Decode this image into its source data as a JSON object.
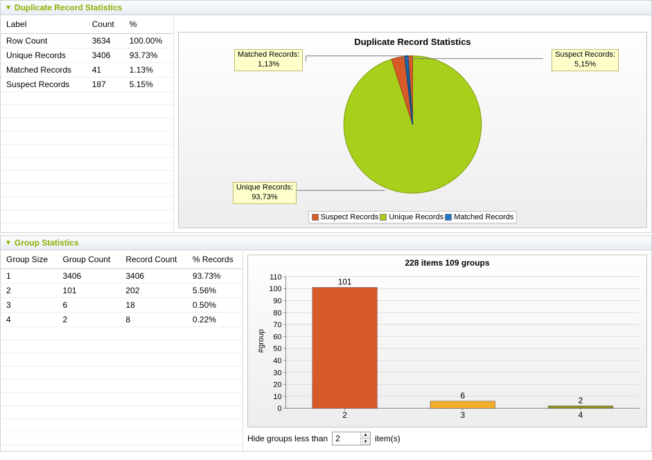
{
  "panel1": {
    "title": "Duplicate Record Statistics",
    "table": {
      "headers": [
        "Label",
        "Count",
        "%"
      ],
      "rows": [
        {
          "label": "Row Count",
          "count": "3634",
          "pct": "100.00%"
        },
        {
          "label": "Unique Records",
          "count": "3406",
          "pct": "93.73%"
        },
        {
          "label": "Matched Records",
          "count": "41",
          "pct": "1.13%"
        },
        {
          "label": "Suspect Records",
          "count": "187",
          "pct": "5.15%"
        }
      ]
    },
    "chart_title": "Duplicate Record Statistics",
    "callouts": {
      "matched": {
        "l1": "Matched Records:",
        "l2": "1,13%"
      },
      "suspect": {
        "l1": "Suspect Records:",
        "l2": "5,15%"
      },
      "unique": {
        "l1": "Unique Records:",
        "l2": "93,73%"
      }
    },
    "legend": [
      "Suspect Records",
      "Unique Records",
      "Matched Records"
    ],
    "legend_colors": [
      "#d85a28",
      "#a8cf1c",
      "#1c77c8"
    ]
  },
  "panel2": {
    "title": "Group Statistics",
    "table": {
      "headers": [
        "Group Size",
        "Group Count",
        "Record Count",
        "% Records"
      ],
      "rows": [
        {
          "c0": "1",
          "c1": "3406",
          "c2": "3406",
          "c3": "93.73%"
        },
        {
          "c0": "2",
          "c1": "101",
          "c2": "202",
          "c3": "5.56%"
        },
        {
          "c0": "3",
          "c1": "6",
          "c2": "18",
          "c3": "0.50%"
        },
        {
          "c0": "4",
          "c1": "2",
          "c2": "8",
          "c3": "0.22%"
        }
      ]
    },
    "bar_title": "228 items 109 groups",
    "ylabel": "#group",
    "filter": {
      "prefix": "Hide groups less than",
      "value": "2",
      "suffix": "item(s)"
    }
  },
  "chart_data": [
    {
      "type": "pie",
      "title": "Duplicate Record Statistics",
      "series": [
        {
          "name": "Unique Records",
          "value": 93.73,
          "color": "#a8cf1c"
        },
        {
          "name": "Suspect Records",
          "value": 5.15,
          "color": "#d85a28"
        },
        {
          "name": "Matched Records",
          "value": 1.13,
          "color": "#1c77c8"
        }
      ]
    },
    {
      "type": "bar",
      "title": "228 items 109 groups",
      "ylabel": "#group",
      "ylim": [
        0,
        110
      ],
      "yticks": [
        0,
        10,
        20,
        30,
        40,
        50,
        60,
        70,
        80,
        90,
        100,
        110
      ],
      "categories": [
        "2",
        "3",
        "4"
      ],
      "values": [
        101,
        6,
        2
      ],
      "colors": [
        "#d85a28",
        "#f0ad2c",
        "#8a8c1d"
      ]
    }
  ]
}
